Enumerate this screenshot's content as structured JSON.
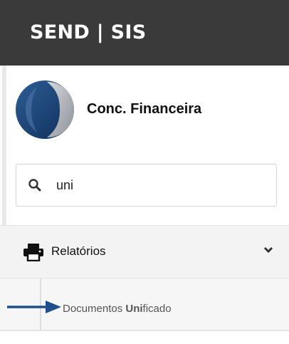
{
  "header": {
    "brand": "SEND | SIS",
    "background": "#3a3a3a"
  },
  "profile": {
    "name": "Conc. Financeira",
    "logo_icon": "company-logo"
  },
  "search": {
    "icon": "search-icon",
    "value": "uni"
  },
  "menu": {
    "section": {
      "icon": "printer-icon",
      "label": "Relatórios",
      "expander_icon": "chevron-down-icon",
      "expanded": true
    },
    "items": [
      {
        "label_prefix": "Documentos ",
        "label_match": "Uni",
        "label_suffix": "ficado",
        "highlighted": true
      }
    ]
  },
  "annotation": {
    "icon": "arrow-right-icon",
    "color": "#1f4e8c"
  }
}
